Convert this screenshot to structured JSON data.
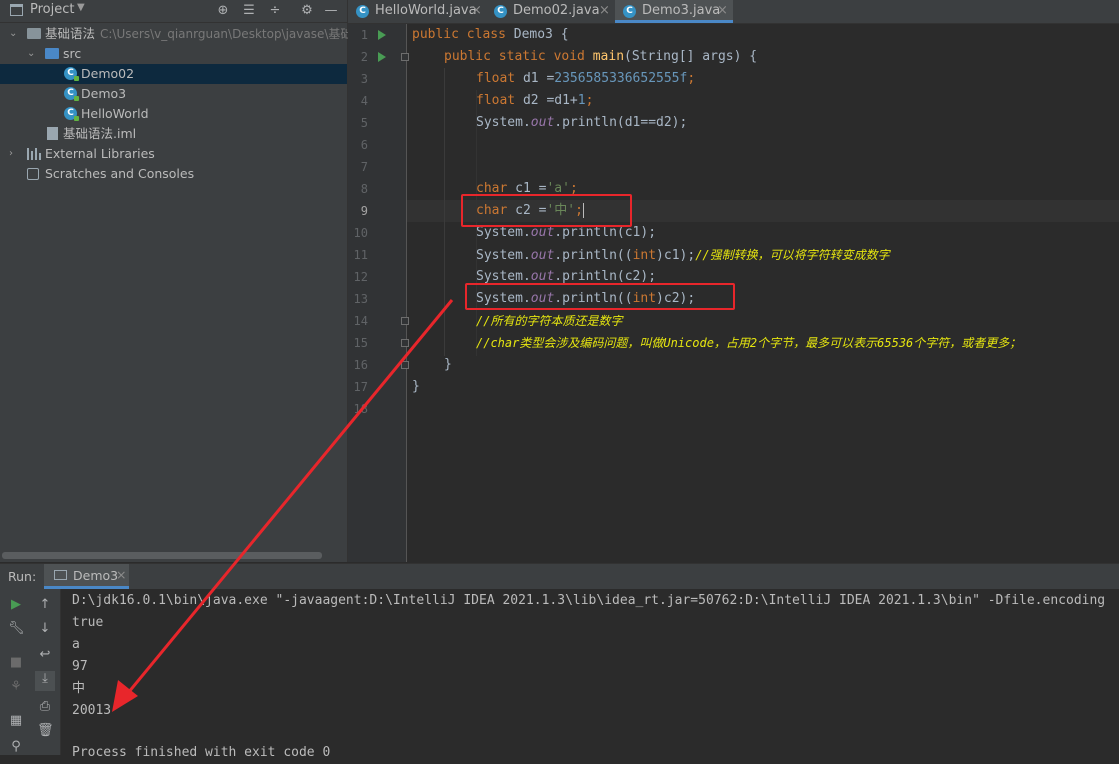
{
  "project_panel": {
    "title": "Project",
    "tree": [
      {
        "label": "基础语法",
        "hint": "C:\\Users\\v_qianrguan\\Desktop\\javase\\基础"
      },
      {
        "label": "src"
      },
      {
        "label": "Demo02",
        "selected": true
      },
      {
        "label": "Demo3"
      },
      {
        "label": "HelloWorld"
      },
      {
        "label": "基础语法.iml"
      },
      {
        "label": "External Libraries"
      },
      {
        "label": "Scratches and Consoles"
      }
    ]
  },
  "tabs": [
    {
      "label": "HelloWorld.java"
    },
    {
      "label": "Demo02.java"
    },
    {
      "label": "Demo3.java",
      "active": true
    }
  ],
  "editor": {
    "line_numbers": [
      "1",
      "2",
      "3",
      "4",
      "5",
      "6",
      "7",
      "8",
      "9",
      "10",
      "11",
      "12",
      "13",
      "14",
      "15",
      "16",
      "17",
      "18"
    ],
    "l1": {
      "kw": "public class ",
      "name": "Demo3 {"
    },
    "l2": {
      "kw": "public static void ",
      "fn": "main",
      "rest": "(String[] args) {"
    },
    "l3": {
      "kw": "float ",
      "a": "d1 =",
      "num": "2356585336652555f",
      "end": ";"
    },
    "l4": {
      "kw": "float ",
      "a": "d2 =d1+",
      "num": "1",
      "end": ";"
    },
    "l5": {
      "a": "System.",
      "fld": "out",
      "b": ".println(d1==d2);"
    },
    "l8": {
      "kw": "char ",
      "a": "c1 =",
      "str": "'a'",
      "end": ";"
    },
    "l9": {
      "kw": "char ",
      "a": "c2 =",
      "str": "'中'",
      "end": ";"
    },
    "l10": {
      "a": "System.",
      "fld": "out",
      "b": ".println(c1);"
    },
    "l11": {
      "a": "System.",
      "fld": "out",
      "b": ".println((",
      "kw": "int",
      "c": ")c1);",
      "cmt": "//强制转换，可以将字符转变成数字"
    },
    "l12": {
      "a": "System.",
      "fld": "out",
      "b": ".println(c2);"
    },
    "l13": {
      "a": "System.",
      "fld": "out",
      "b": ".println((",
      "kw": "int",
      "c": ")c2);"
    },
    "l14": {
      "cmt": "//所有的字符本质还是数字"
    },
    "l15": {
      "cmt": "//char类型会涉及编码问题，叫做Unicode，占用2个字节，最多可以表示65536个字符，或者更多；"
    },
    "l16": {
      "a": "}"
    },
    "l17": {
      "a": "}"
    }
  },
  "run": {
    "label": "Run:",
    "tab": "Demo3",
    "output": [
      "D:\\jdk16.0.1\\bin\\java.exe \"-javaagent:D:\\IntelliJ IDEA 2021.1.3\\lib\\idea_rt.jar=50762:D:\\IntelliJ IDEA 2021.1.3\\bin\" -Dfile.encoding",
      "true",
      "a",
      "97",
      "中",
      "20013",
      "",
      "Process finished with exit code 0"
    ]
  },
  "colors": {
    "annotation": "#e8262b",
    "accent": "#4a88c7"
  }
}
